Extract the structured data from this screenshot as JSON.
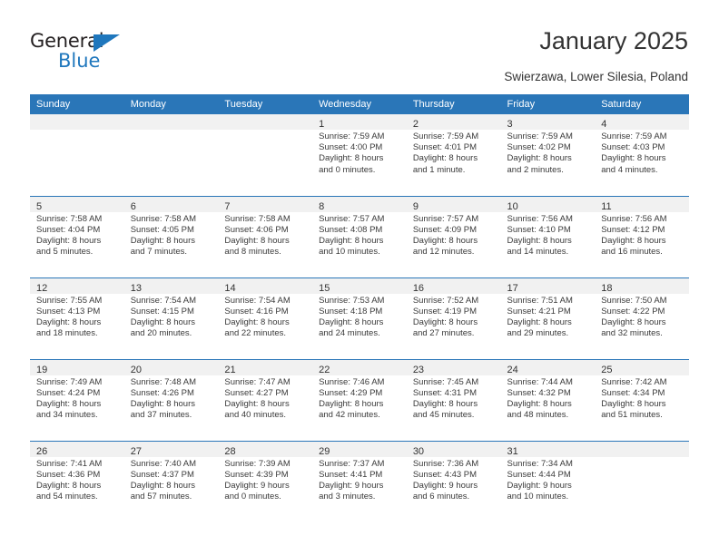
{
  "brand": {
    "name_top": "General",
    "name_bottom": "Blue",
    "accent_color": "#1f77bd"
  },
  "header": {
    "title": "January 2025",
    "subtitle": "Swierzawa, Lower Silesia, Poland",
    "header_bg_color": "#2a76b8",
    "daynum_strip_color": "#f1f1f1"
  },
  "weekday_headers": [
    "Sunday",
    "Monday",
    "Tuesday",
    "Wednesday",
    "Thursday",
    "Friday",
    "Saturday"
  ],
  "weeks": [
    [
      {
        "day": "",
        "sunrise": "",
        "sunset": "",
        "daylight_line1": "",
        "daylight_line2": ""
      },
      {
        "day": "",
        "sunrise": "",
        "sunset": "",
        "daylight_line1": "",
        "daylight_line2": ""
      },
      {
        "day": "",
        "sunrise": "",
        "sunset": "",
        "daylight_line1": "",
        "daylight_line2": ""
      },
      {
        "day": "1",
        "sunrise": "Sunrise: 7:59 AM",
        "sunset": "Sunset: 4:00 PM",
        "daylight_line1": "Daylight: 8 hours",
        "daylight_line2": "and 0 minutes."
      },
      {
        "day": "2",
        "sunrise": "Sunrise: 7:59 AM",
        "sunset": "Sunset: 4:01 PM",
        "daylight_line1": "Daylight: 8 hours",
        "daylight_line2": "and 1 minute."
      },
      {
        "day": "3",
        "sunrise": "Sunrise: 7:59 AM",
        "sunset": "Sunset: 4:02 PM",
        "daylight_line1": "Daylight: 8 hours",
        "daylight_line2": "and 2 minutes."
      },
      {
        "day": "4",
        "sunrise": "Sunrise: 7:59 AM",
        "sunset": "Sunset: 4:03 PM",
        "daylight_line1": "Daylight: 8 hours",
        "daylight_line2": "and 4 minutes."
      }
    ],
    [
      {
        "day": "5",
        "sunrise": "Sunrise: 7:58 AM",
        "sunset": "Sunset: 4:04 PM",
        "daylight_line1": "Daylight: 8 hours",
        "daylight_line2": "and 5 minutes."
      },
      {
        "day": "6",
        "sunrise": "Sunrise: 7:58 AM",
        "sunset": "Sunset: 4:05 PM",
        "daylight_line1": "Daylight: 8 hours",
        "daylight_line2": "and 7 minutes."
      },
      {
        "day": "7",
        "sunrise": "Sunrise: 7:58 AM",
        "sunset": "Sunset: 4:06 PM",
        "daylight_line1": "Daylight: 8 hours",
        "daylight_line2": "and 8 minutes."
      },
      {
        "day": "8",
        "sunrise": "Sunrise: 7:57 AM",
        "sunset": "Sunset: 4:08 PM",
        "daylight_line1": "Daylight: 8 hours",
        "daylight_line2": "and 10 minutes."
      },
      {
        "day": "9",
        "sunrise": "Sunrise: 7:57 AM",
        "sunset": "Sunset: 4:09 PM",
        "daylight_line1": "Daylight: 8 hours",
        "daylight_line2": "and 12 minutes."
      },
      {
        "day": "10",
        "sunrise": "Sunrise: 7:56 AM",
        "sunset": "Sunset: 4:10 PM",
        "daylight_line1": "Daylight: 8 hours",
        "daylight_line2": "and 14 minutes."
      },
      {
        "day": "11",
        "sunrise": "Sunrise: 7:56 AM",
        "sunset": "Sunset: 4:12 PM",
        "daylight_line1": "Daylight: 8 hours",
        "daylight_line2": "and 16 minutes."
      }
    ],
    [
      {
        "day": "12",
        "sunrise": "Sunrise: 7:55 AM",
        "sunset": "Sunset: 4:13 PM",
        "daylight_line1": "Daylight: 8 hours",
        "daylight_line2": "and 18 minutes."
      },
      {
        "day": "13",
        "sunrise": "Sunrise: 7:54 AM",
        "sunset": "Sunset: 4:15 PM",
        "daylight_line1": "Daylight: 8 hours",
        "daylight_line2": "and 20 minutes."
      },
      {
        "day": "14",
        "sunrise": "Sunrise: 7:54 AM",
        "sunset": "Sunset: 4:16 PM",
        "daylight_line1": "Daylight: 8 hours",
        "daylight_line2": "and 22 minutes."
      },
      {
        "day": "15",
        "sunrise": "Sunrise: 7:53 AM",
        "sunset": "Sunset: 4:18 PM",
        "daylight_line1": "Daylight: 8 hours",
        "daylight_line2": "and 24 minutes."
      },
      {
        "day": "16",
        "sunrise": "Sunrise: 7:52 AM",
        "sunset": "Sunset: 4:19 PM",
        "daylight_line1": "Daylight: 8 hours",
        "daylight_line2": "and 27 minutes."
      },
      {
        "day": "17",
        "sunrise": "Sunrise: 7:51 AM",
        "sunset": "Sunset: 4:21 PM",
        "daylight_line1": "Daylight: 8 hours",
        "daylight_line2": "and 29 minutes."
      },
      {
        "day": "18",
        "sunrise": "Sunrise: 7:50 AM",
        "sunset": "Sunset: 4:22 PM",
        "daylight_line1": "Daylight: 8 hours",
        "daylight_line2": "and 32 minutes."
      }
    ],
    [
      {
        "day": "19",
        "sunrise": "Sunrise: 7:49 AM",
        "sunset": "Sunset: 4:24 PM",
        "daylight_line1": "Daylight: 8 hours",
        "daylight_line2": "and 34 minutes."
      },
      {
        "day": "20",
        "sunrise": "Sunrise: 7:48 AM",
        "sunset": "Sunset: 4:26 PM",
        "daylight_line1": "Daylight: 8 hours",
        "daylight_line2": "and 37 minutes."
      },
      {
        "day": "21",
        "sunrise": "Sunrise: 7:47 AM",
        "sunset": "Sunset: 4:27 PM",
        "daylight_line1": "Daylight: 8 hours",
        "daylight_line2": "and 40 minutes."
      },
      {
        "day": "22",
        "sunrise": "Sunrise: 7:46 AM",
        "sunset": "Sunset: 4:29 PM",
        "daylight_line1": "Daylight: 8 hours",
        "daylight_line2": "and 42 minutes."
      },
      {
        "day": "23",
        "sunrise": "Sunrise: 7:45 AM",
        "sunset": "Sunset: 4:31 PM",
        "daylight_line1": "Daylight: 8 hours",
        "daylight_line2": "and 45 minutes."
      },
      {
        "day": "24",
        "sunrise": "Sunrise: 7:44 AM",
        "sunset": "Sunset: 4:32 PM",
        "daylight_line1": "Daylight: 8 hours",
        "daylight_line2": "and 48 minutes."
      },
      {
        "day": "25",
        "sunrise": "Sunrise: 7:42 AM",
        "sunset": "Sunset: 4:34 PM",
        "daylight_line1": "Daylight: 8 hours",
        "daylight_line2": "and 51 minutes."
      }
    ],
    [
      {
        "day": "26",
        "sunrise": "Sunrise: 7:41 AM",
        "sunset": "Sunset: 4:36 PM",
        "daylight_line1": "Daylight: 8 hours",
        "daylight_line2": "and 54 minutes."
      },
      {
        "day": "27",
        "sunrise": "Sunrise: 7:40 AM",
        "sunset": "Sunset: 4:37 PM",
        "daylight_line1": "Daylight: 8 hours",
        "daylight_line2": "and 57 minutes."
      },
      {
        "day": "28",
        "sunrise": "Sunrise: 7:39 AM",
        "sunset": "Sunset: 4:39 PM",
        "daylight_line1": "Daylight: 9 hours",
        "daylight_line2": "and 0 minutes."
      },
      {
        "day": "29",
        "sunrise": "Sunrise: 7:37 AM",
        "sunset": "Sunset: 4:41 PM",
        "daylight_line1": "Daylight: 9 hours",
        "daylight_line2": "and 3 minutes."
      },
      {
        "day": "30",
        "sunrise": "Sunrise: 7:36 AM",
        "sunset": "Sunset: 4:43 PM",
        "daylight_line1": "Daylight: 9 hours",
        "daylight_line2": "and 6 minutes."
      },
      {
        "day": "31",
        "sunrise": "Sunrise: 7:34 AM",
        "sunset": "Sunset: 4:44 PM",
        "daylight_line1": "Daylight: 9 hours",
        "daylight_line2": "and 10 minutes."
      },
      {
        "day": "",
        "sunrise": "",
        "sunset": "",
        "daylight_line1": "",
        "daylight_line2": ""
      }
    ]
  ]
}
